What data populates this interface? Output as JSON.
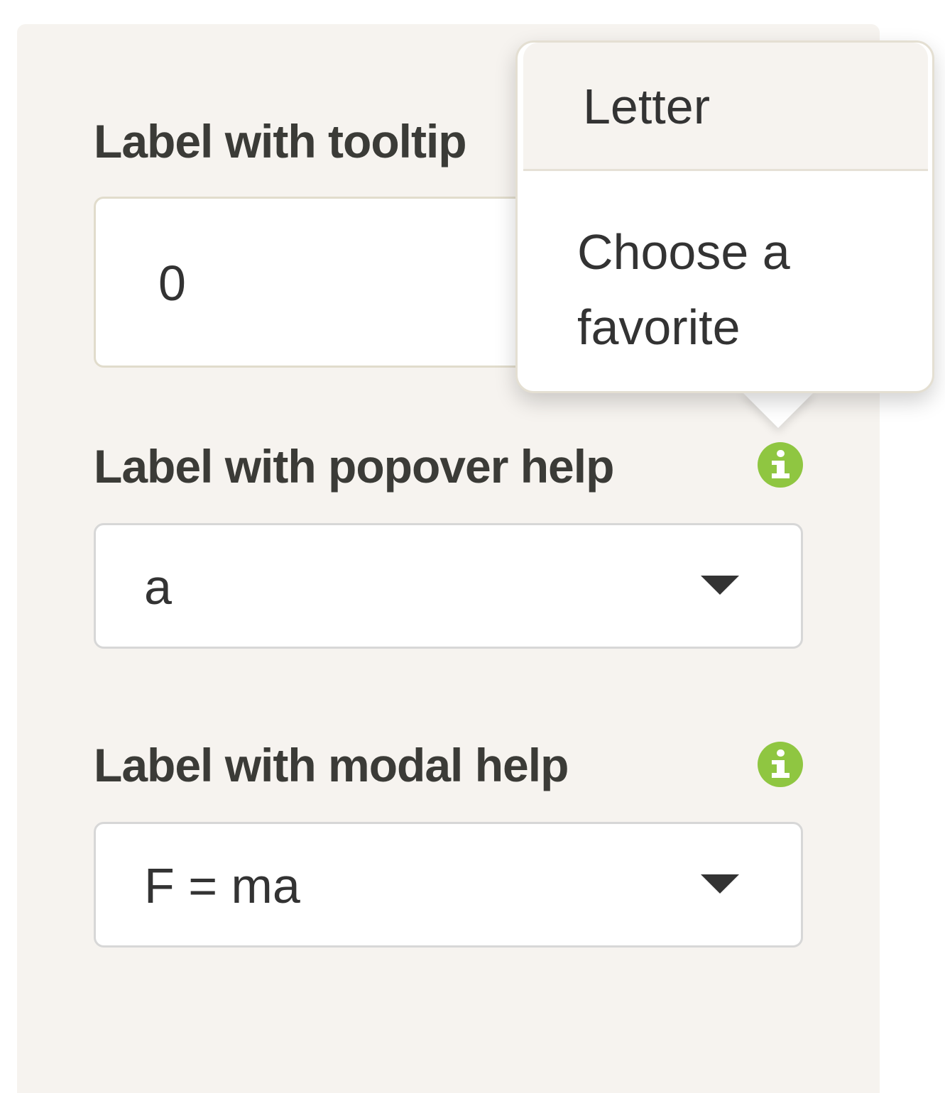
{
  "fields": {
    "tooltip": {
      "label": "Label with tooltip",
      "value": "0"
    },
    "popover": {
      "label": "Label with popover help",
      "selected": "a",
      "help_icon": "info-circle-icon"
    },
    "modal": {
      "label": "Label with modal help",
      "selected": "F = ma",
      "help_icon": "info-circle-icon"
    }
  },
  "popover_help": {
    "title": "Letter",
    "content": "Choose a favorite"
  },
  "colors": {
    "panel_background": "#f6f3ef",
    "info_icon": "#8fc641",
    "label_text": "#3b3b37"
  }
}
